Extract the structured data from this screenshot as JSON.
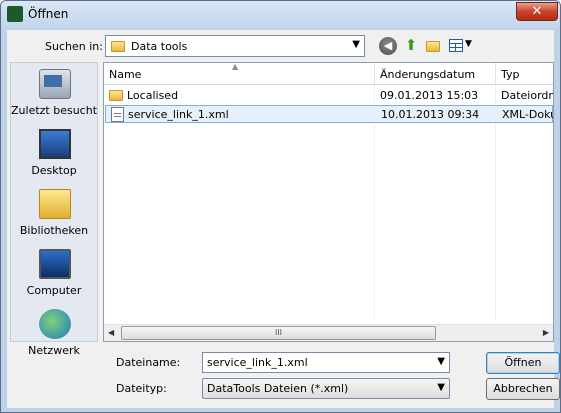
{
  "window": {
    "title": "Öffnen",
    "close_glyph": "✕"
  },
  "lookin": {
    "label": "Suchen in:",
    "value": "Data tools"
  },
  "places": [
    {
      "label": "Zuletzt besucht",
      "icon": "recent-places-icon"
    },
    {
      "label": "Desktop",
      "icon": "desktop-icon"
    },
    {
      "label": "Bibliotheken",
      "icon": "libraries-icon"
    },
    {
      "label": "Computer",
      "icon": "computer-icon"
    },
    {
      "label": "Netzwerk",
      "icon": "network-icon"
    }
  ],
  "columns": {
    "name": "Name",
    "date": "Änderungsdatum",
    "type": "Typ"
  },
  "files": [
    {
      "name": "Localised",
      "date": "09.01.2013 15:03",
      "type": "Dateiordne",
      "icon": "folder-icon",
      "selected": false
    },
    {
      "name": "service_link_1.xml",
      "date": "10.01.2013 09:34",
      "type": "XML-Doku",
      "icon": "xml-file-icon",
      "selected": true
    }
  ],
  "filename": {
    "label": "Dateiname:",
    "value": "service_link_1.xml"
  },
  "filetype": {
    "label": "Dateityp:",
    "value": "DataTools Dateien (*.xml)"
  },
  "buttons": {
    "open": "Öffnen",
    "cancel": "Abbrechen"
  },
  "scroll": {
    "thumb_glyph": "III"
  }
}
